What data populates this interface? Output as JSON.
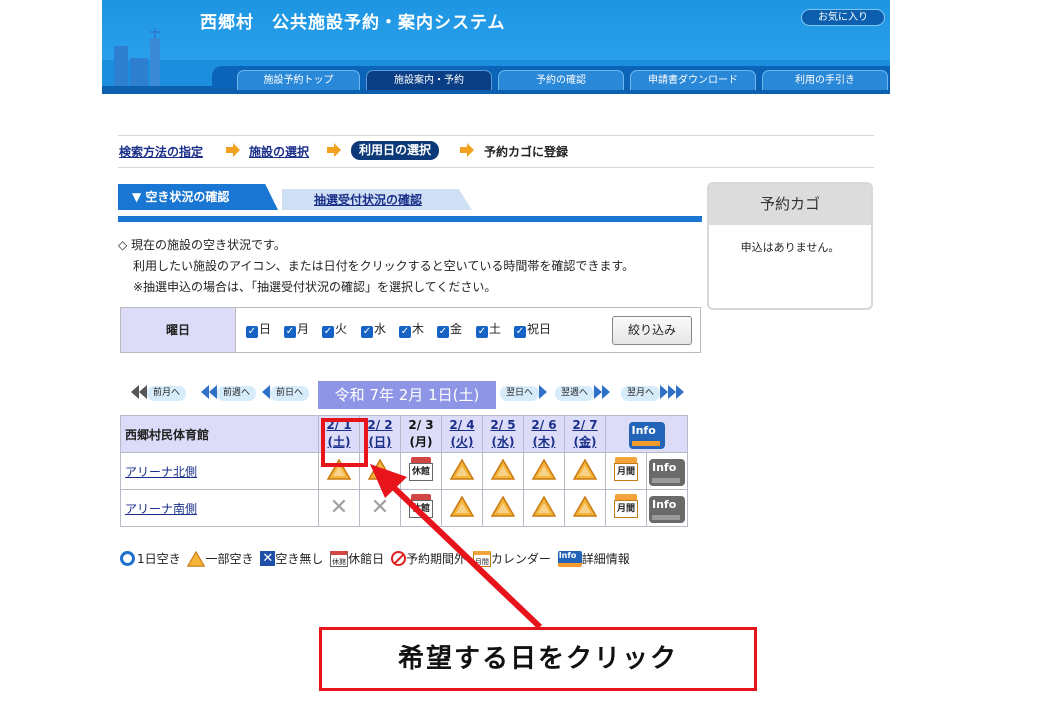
{
  "header": {
    "site_title": "西郷村　公共施設予約・案内システム",
    "favorites_label": "お気に入り",
    "nav": [
      {
        "label": "施設予約トップ"
      },
      {
        "label": "施設案内・予約"
      },
      {
        "label": "予約の確認"
      },
      {
        "label": "申請書ダウンロード"
      },
      {
        "label": "利用の手引き"
      }
    ]
  },
  "breadcrumb": {
    "step1": "検索方法の指定",
    "step2": "施設の選択",
    "step3": "利用日の選択",
    "step4": "予約カゴに登録"
  },
  "tabs": {
    "availability": "▼ 空き状況の確認",
    "lottery": "抽選受付状況の確認"
  },
  "description": {
    "line1": "◇ 現在の施設の空き状況です。",
    "line2": "利用したい施設のアイコン、または日付をクリックすると空いている時間帯を確認できます。",
    "line3": "※抽選申込の場合は、「抽選受付状況の確認」を選択してください。"
  },
  "filter": {
    "label": "曜日",
    "days": [
      "日",
      "月",
      "火",
      "水",
      "木",
      "金",
      "土",
      "祝日"
    ],
    "button": "絞り込み"
  },
  "date_nav": {
    "prev_month": "前月へ",
    "prev_week": "前週へ",
    "prev_day": "前日へ",
    "current": "令和 7年 2月 1日(土)",
    "next_day": "翌日へ",
    "next_week": "翌週へ",
    "next_month": "翌月へ"
  },
  "calendar": {
    "facility": "西郷村民体育館",
    "dates": [
      {
        "date": "2/ 1",
        "dow": "(土)",
        "link": true
      },
      {
        "date": "2/ 2",
        "dow": "(日)",
        "link": true
      },
      {
        "date": "2/ 3",
        "dow": "(月)",
        "link": false
      },
      {
        "date": "2/ 4",
        "dow": "(火)",
        "link": true
      },
      {
        "date": "2/ 5",
        "dow": "(水)",
        "link": true
      },
      {
        "date": "2/ 6",
        "dow": "(木)",
        "link": true
      },
      {
        "date": "2/ 7",
        "dow": "(金)",
        "link": true
      }
    ],
    "rooms": [
      {
        "name": "アリーナ北側",
        "status": [
          "partial",
          "partial",
          "closed",
          "partial",
          "partial",
          "partial",
          "partial"
        ]
      },
      {
        "name": "アリーナ南側",
        "status": [
          "full",
          "full",
          "closed",
          "partial",
          "partial",
          "partial",
          "partial"
        ]
      }
    ],
    "closed_icon_text": "休館",
    "month_icon_text": "月間",
    "info_icon_text": "Info"
  },
  "legend": {
    "available": "1日空き",
    "partial": "一部空き",
    "full": "空き無し",
    "closed": "休館日",
    "out_of_period": "予約期間外",
    "calendar": "カレンダー",
    "details": "詳細情報"
  },
  "cart": {
    "title": "予約カゴ",
    "empty": "申込はありません。"
  },
  "annotation": {
    "callout": "希望する日をクリック"
  },
  "colors": {
    "banner": "#1b8fde",
    "accent": "#1976d2",
    "highlight": "#e8141b"
  }
}
